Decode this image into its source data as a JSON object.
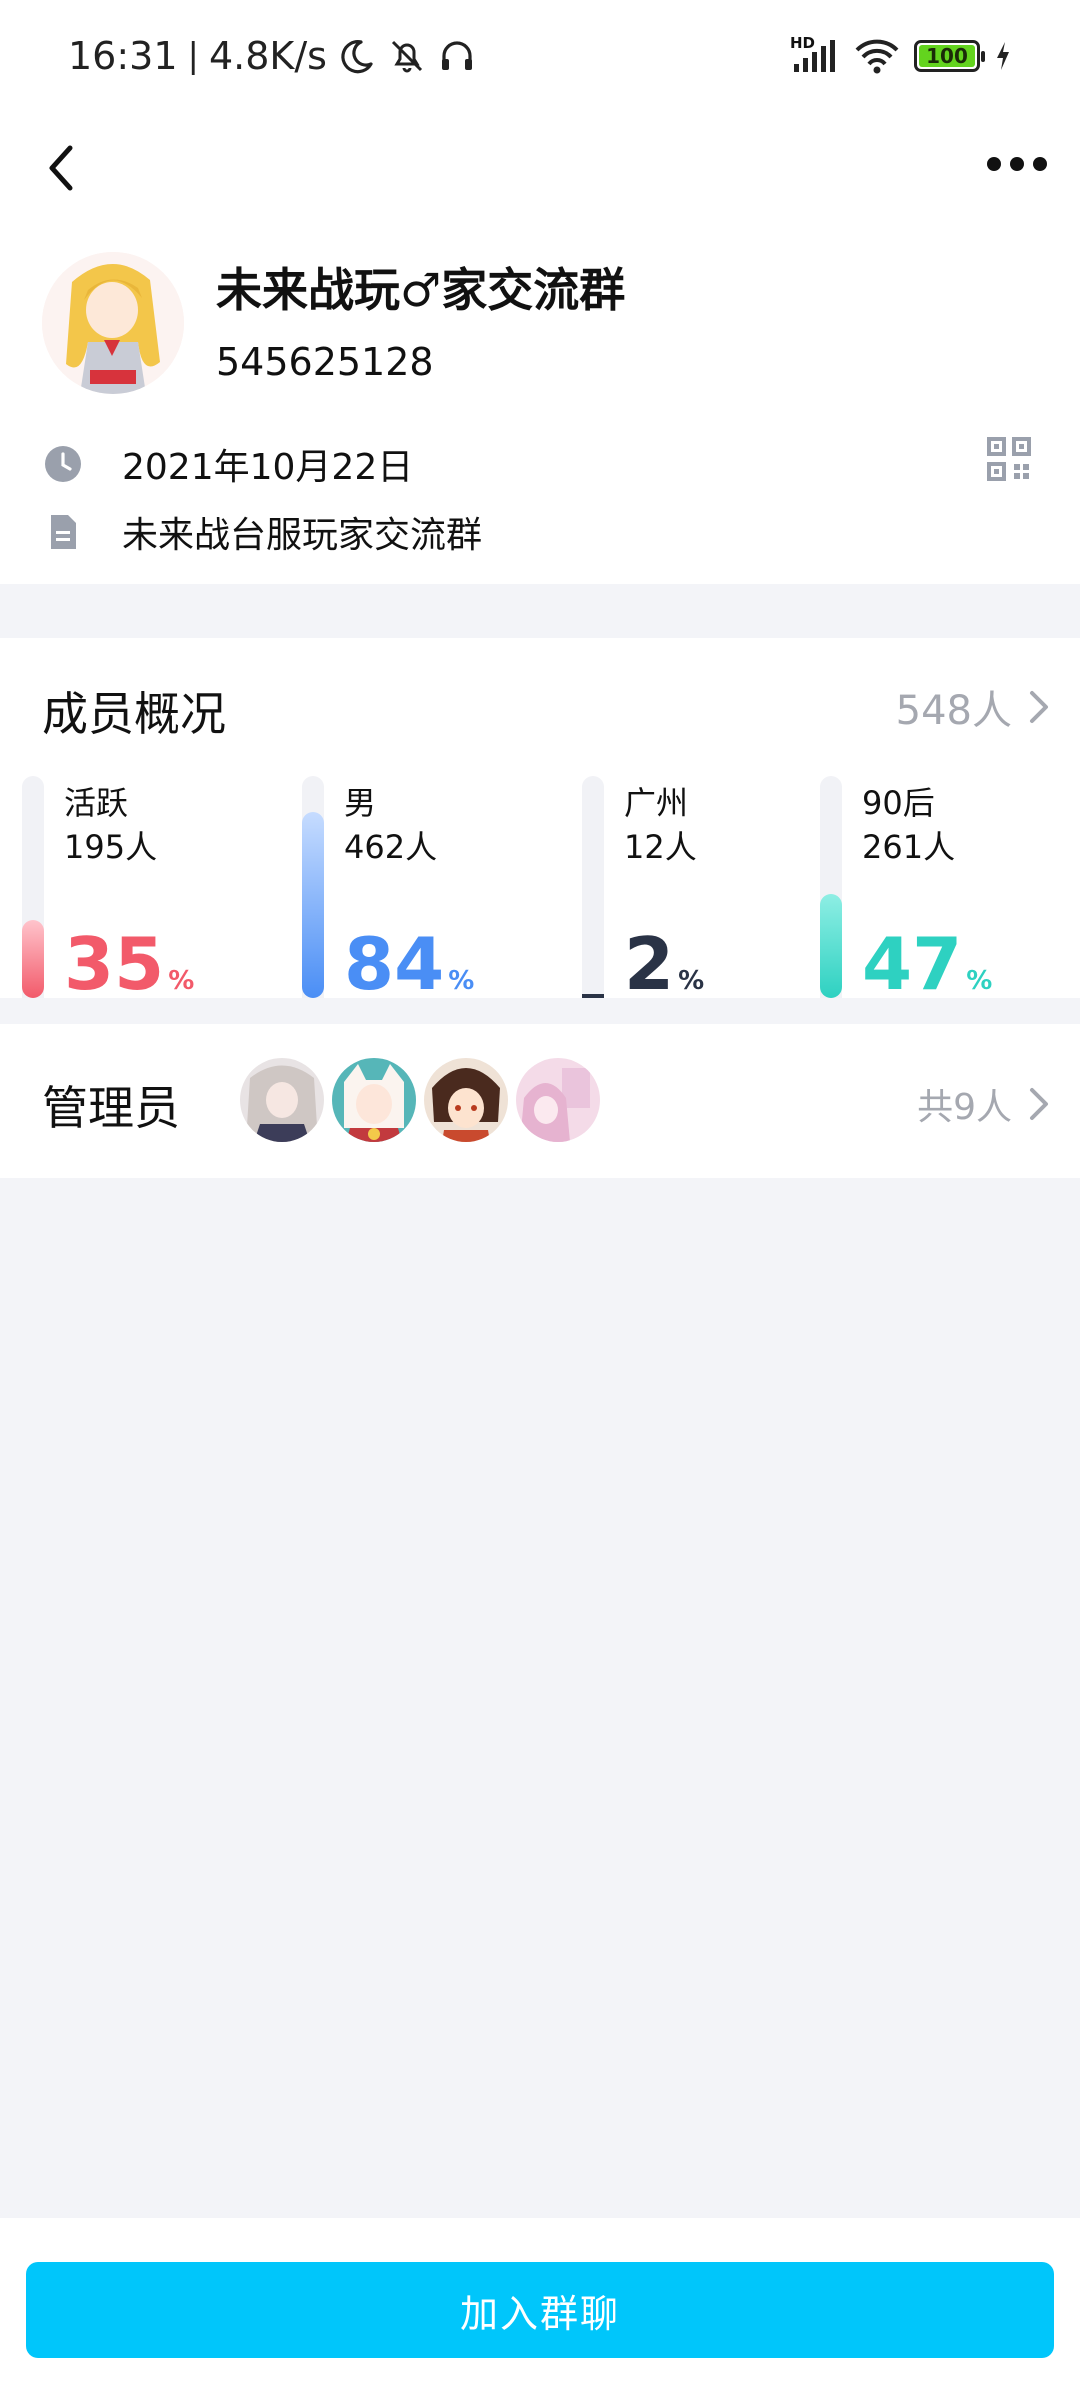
{
  "status_bar": {
    "time": "16:31",
    "speed": "4.8K/s",
    "network": "HD",
    "battery": "100"
  },
  "header": {
    "group_name": "未来战玩♂家交流群",
    "group_id": "545625128",
    "created_date": "2021年10月22日",
    "description": "未来战台服玩家交流群"
  },
  "members": {
    "title": "成员概况",
    "total": "548人",
    "stats": [
      {
        "label": "活跃",
        "count": "195人",
        "percent": "35",
        "unit": "%",
        "fraction": 0.35,
        "color": "#f25a6a",
        "gradient": "#ffc4cc"
      },
      {
        "label": "男",
        "count": "462人",
        "percent": "84",
        "unit": "%",
        "fraction": 0.84,
        "color": "#4a8ef5",
        "gradient": "#c6dcff"
      },
      {
        "label": "广州",
        "count": "12人",
        "percent": "2",
        "unit": "%",
        "fraction": 0.02,
        "color": "#2a3346",
        "gradient": "#2a3346"
      },
      {
        "label": "90后",
        "count": "261人",
        "percent": "47",
        "unit": "%",
        "fraction": 0.47,
        "color": "#2ed1c1",
        "gradient": "#8eeee4"
      }
    ]
  },
  "admins": {
    "title": "管理员",
    "total": "共9人"
  },
  "join_button": "加入群聊"
}
